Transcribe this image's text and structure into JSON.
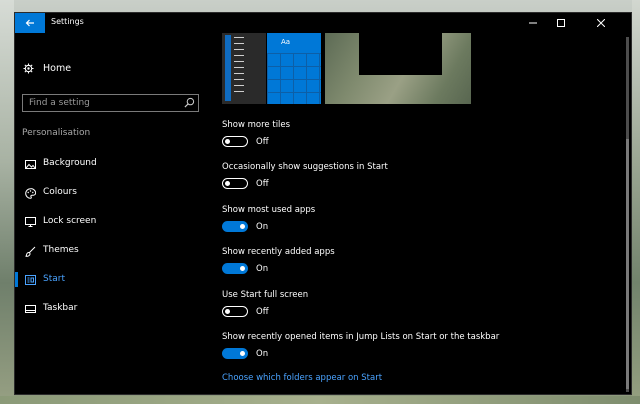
{
  "window": {
    "title": "Settings"
  },
  "sidebar": {
    "home_label": "Home",
    "search_placeholder": "Find a setting",
    "section_label": "Personalisation",
    "items": [
      {
        "label": "Background",
        "icon": "image-icon"
      },
      {
        "label": "Colours",
        "icon": "palette-icon"
      },
      {
        "label": "Lock screen",
        "icon": "monitor-icon"
      },
      {
        "label": "Themes",
        "icon": "brush-icon"
      },
      {
        "label": "Start",
        "icon": "start-icon",
        "active": true
      },
      {
        "label": "Taskbar",
        "icon": "taskbar-icon"
      }
    ]
  },
  "preview": {
    "tile_text": "Aa"
  },
  "settings": [
    {
      "label": "Show more tiles",
      "state": "Off"
    },
    {
      "label": "Occasionally show suggestions in Start",
      "state": "Off"
    },
    {
      "label": "Show most used apps",
      "state": "On"
    },
    {
      "label": "Show recently added apps",
      "state": "On"
    },
    {
      "label": "Use Start full screen",
      "state": "Off"
    },
    {
      "label": "Show recently opened items in Jump Lists on Start or the taskbar",
      "state": "On"
    }
  ],
  "link": "Choose which folders appear on Start",
  "colors": {
    "accent": "#0078d7",
    "link": "#4aa3ff",
    "background": "#000000"
  }
}
